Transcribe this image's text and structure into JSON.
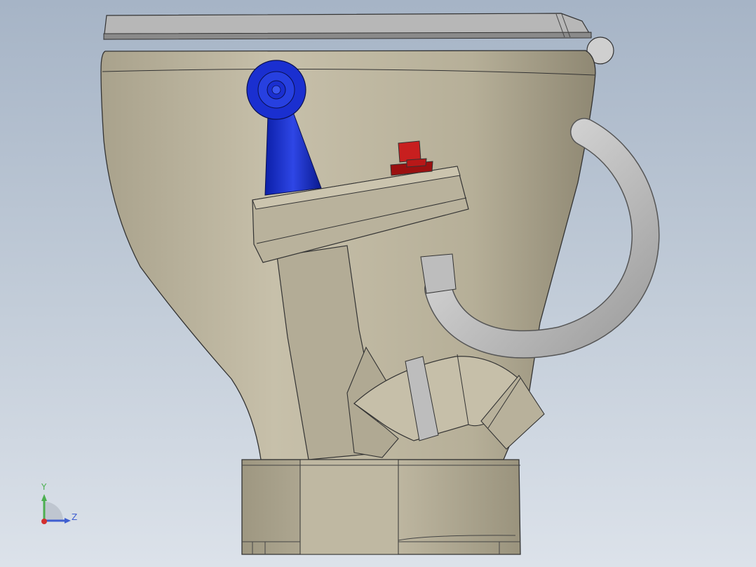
{
  "viewport": {
    "background_top": "#a6b4c6",
    "background_bottom": "#dce2ea"
  },
  "model": {
    "body_color": "#bdb6a0",
    "handle_color": "#1a2fd0",
    "button_color": "#b81818",
    "hose_color": "#c8c8c8"
  },
  "triad": {
    "y_label": "Y",
    "z_label": "Z",
    "y_color": "#4caf50",
    "z_color": "#3f5fd0",
    "origin_color": "#d32f2f"
  }
}
